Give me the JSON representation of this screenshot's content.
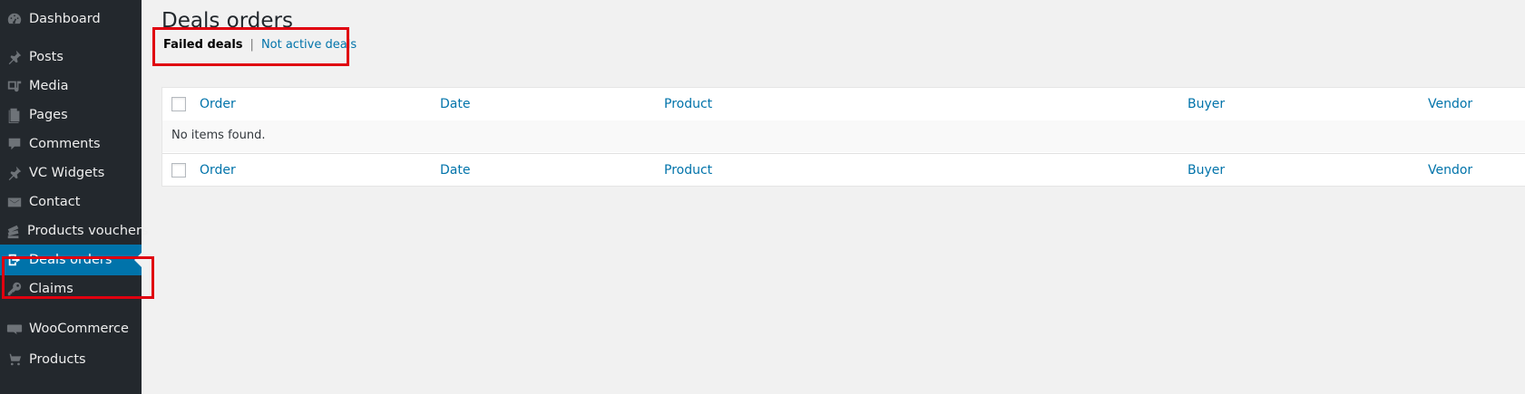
{
  "sidebar": {
    "items": [
      {
        "label": "Dashboard",
        "icon": "dashboard-icon"
      },
      {
        "label": "Posts",
        "icon": "pin-icon"
      },
      {
        "label": "Media",
        "icon": "media-icon"
      },
      {
        "label": "Pages",
        "icon": "pages-icon"
      },
      {
        "label": "Comments",
        "icon": "comment-icon"
      },
      {
        "label": "VC Widgets",
        "icon": "pin-icon"
      },
      {
        "label": "Contact",
        "icon": "envelope-icon"
      },
      {
        "label": "Products vouchers",
        "icon": "tickets-icon"
      },
      {
        "label": "Deals orders",
        "icon": "exit-icon",
        "active": true
      },
      {
        "label": "Claims",
        "icon": "key-icon"
      },
      {
        "label": "WooCommerce",
        "icon": "woocommerce-icon"
      },
      {
        "label": "Products",
        "icon": "cart-icon"
      }
    ]
  },
  "page": {
    "title": "Deals orders",
    "views": {
      "current": "Failed deals",
      "separator": "|",
      "other": "Not active deals"
    }
  },
  "table": {
    "columns": [
      "Order",
      "Date",
      "Product",
      "Buyer",
      "Vendor"
    ],
    "empty_message": "No items found."
  },
  "colors": {
    "sidebar_bg": "#23282d",
    "active_bg": "#0073aa",
    "link": "#0073aa",
    "highlight": "#e0000f"
  }
}
